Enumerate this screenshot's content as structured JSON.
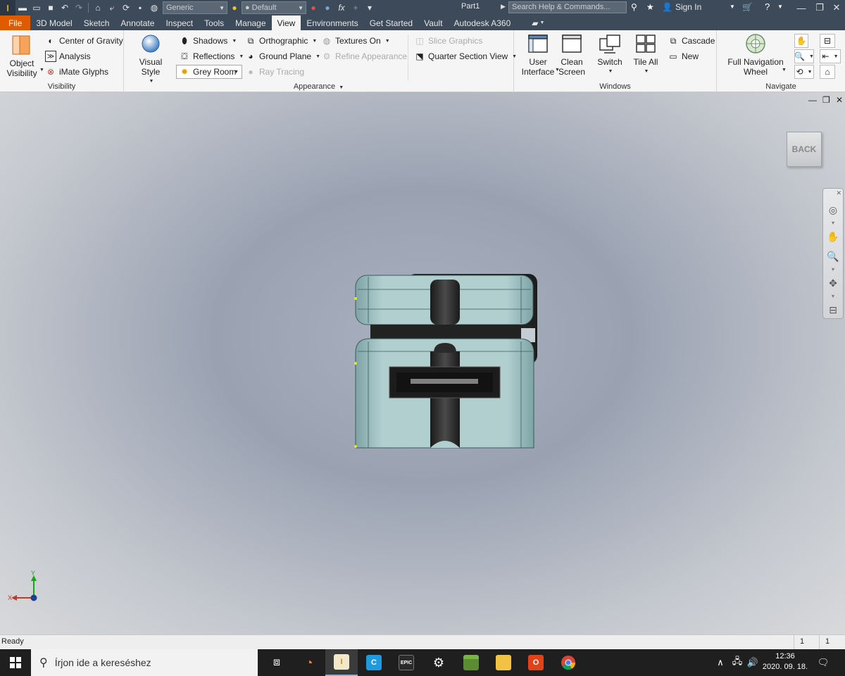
{
  "titlebar": {
    "app_logo": "I",
    "style_combo": "Generic",
    "appearance_combo": "Default",
    "document_title": "Part1",
    "search_placeholder": "Search Help & Commands...",
    "sign_in": "Sign In"
  },
  "tabs": [
    "File",
    "3D Model",
    "Sketch",
    "Annotate",
    "Inspect",
    "Tools",
    "Manage",
    "View",
    "Environments",
    "Get Started",
    "Vault",
    "Autodesk A360"
  ],
  "active_tab": "View",
  "ribbon": {
    "visibility": {
      "label": "Visibility",
      "object_visibility": "Object\nVisibility",
      "center_of_gravity": "Center of Gravity",
      "analysis": "Analysis",
      "imate_glyphs": "iMate Glyphs"
    },
    "appearance": {
      "label": "Appearance",
      "visual_style": "Visual Style",
      "shadows": "Shadows",
      "reflections": "Reflections",
      "grey_room": "Grey Room",
      "orthographic": "Orthographic",
      "ground_plane": "Ground Plane",
      "ray_tracing": "Ray Tracing",
      "textures_on": "Textures On",
      "refine_appearance": "Refine Appearance",
      "slice_graphics": "Slice Graphics",
      "quarter_section_view": "Quarter Section View"
    },
    "windows": {
      "label": "Windows",
      "user_interface": "User\nInterface",
      "clean_screen": "Clean\nScreen",
      "switch": "Switch",
      "tile_all": "Tile All",
      "cascade": "Cascade",
      "new": "New"
    },
    "navigate": {
      "label": "Navigate",
      "full_navigation_wheel": "Full Navigation\nWheel"
    }
  },
  "viewport": {
    "viewcube_label": "BACK",
    "triad_y": "Y",
    "triad_x": "X"
  },
  "statusbar": {
    "status": "Ready",
    "count_a": "1",
    "count_b": "1"
  },
  "taskbar": {
    "search_placeholder": "Írjon ide a kereséshez",
    "time": "12:36",
    "date": "2020. 09. 18."
  },
  "colors": {
    "titlebar": "#3c4a59",
    "file_tab": "#e05a00",
    "ribbon": "#f5f5f5",
    "taskbar": "#1f1f1f",
    "model_body": "#a9c5c6",
    "model_dark": "#2b2b2b"
  }
}
